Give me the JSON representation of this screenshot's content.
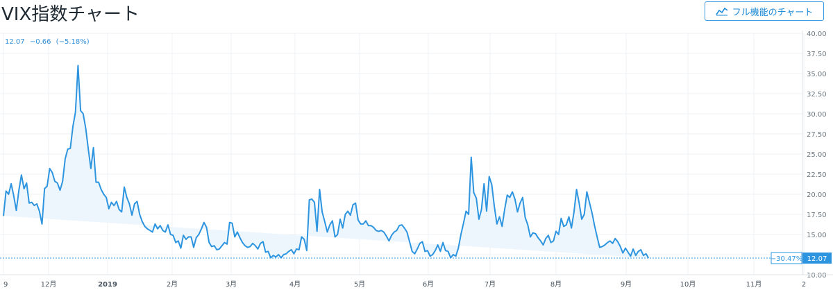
{
  "header": {
    "title": "VIX指数チャート",
    "full_chart_label": "フル機能のチャート",
    "full_chart_icon": "chart-line-icon"
  },
  "readout": {
    "last": "12.07",
    "change": "−0.66",
    "change_pct": "(−5.18%)"
  },
  "price_label": {
    "pct": "−30.47%",
    "value": "12.07"
  },
  "colors": {
    "line": "#2d95e0",
    "fill": "#eef6fd",
    "grid": "#eef1f4",
    "badge": "#2d95e0",
    "text": "#4a5560"
  },
  "chart_data": {
    "type": "area",
    "title": "VIX指数チャート",
    "ylim": [
      10,
      40
    ],
    "yticks": [
      "10.00",
      "12.50",
      "15.00",
      "17.50",
      "20.00",
      "22.50",
      "25.00",
      "27.50",
      "30.00",
      "32.50",
      "35.00",
      "37.50",
      "40.00"
    ],
    "xtick_labels": [
      "9",
      "12月",
      "2019",
      "2月",
      "3月",
      "4月",
      "5月",
      "6月",
      "7月",
      "8月",
      "9月",
      "10月",
      "11月",
      "2"
    ],
    "grid": true,
    "baseline": 12.07,
    "x": [
      1,
      2,
      3,
      4,
      5,
      6,
      7,
      8,
      9,
      10,
      11,
      12,
      13,
      14,
      15,
      16,
      17,
      18,
      19,
      20,
      21,
      22,
      23,
      24,
      25,
      26,
      27,
      28,
      29,
      30,
      31,
      32,
      33,
      34,
      35,
      36,
      37,
      38,
      39,
      40,
      41,
      42,
      43,
      44,
      45,
      46,
      47,
      48,
      49,
      50,
      51,
      52,
      53,
      54,
      55,
      56,
      57,
      58,
      59,
      60,
      61,
      62,
      63,
      64,
      65,
      66,
      67,
      68,
      69,
      70,
      71,
      72,
      73,
      74,
      75,
      76,
      77,
      78,
      79,
      80,
      81,
      82,
      83,
      84,
      85,
      86,
      87,
      88,
      89,
      90,
      91,
      92,
      93,
      94,
      95,
      96,
      97,
      98,
      99,
      100,
      101,
      102,
      103,
      104,
      105,
      106,
      107,
      108,
      109,
      110,
      111,
      112,
      113,
      114,
      115,
      116,
      117,
      118,
      119,
      120,
      121,
      122,
      123,
      124,
      125,
      126,
      127,
      128,
      129,
      130,
      131,
      132,
      133,
      134,
      135,
      136,
      137,
      138,
      139,
      140,
      141,
      142,
      143,
      144,
      145,
      146,
      147,
      148,
      149,
      150,
      151,
      152,
      153,
      154,
      155,
      156,
      157,
      158,
      159,
      160,
      161,
      162,
      163,
      164,
      165,
      166,
      167,
      168,
      169,
      170,
      171,
      172,
      173,
      174,
      175,
      176,
      177,
      178,
      179,
      180,
      181,
      182,
      183,
      184,
      185,
      186,
      187,
      188,
      189,
      190,
      191,
      192,
      193,
      194,
      195,
      196,
      197,
      198,
      199,
      200,
      201,
      202,
      203,
      204,
      205,
      206,
      207,
      208,
      209,
      210,
      211,
      212,
      213,
      214,
      215,
      216,
      217,
      218,
      219,
      220,
      221,
      222,
      223,
      224,
      225,
      226,
      227,
      228,
      229,
      230,
      231,
      232,
      233,
      234,
      235,
      236,
      237,
      238,
      239,
      240,
      241,
      242,
      243,
      244,
      245,
      246,
      247,
      248,
      249,
      250,
      251,
      252,
      253,
      254,
      255,
      256,
      257,
      258,
      259,
      260,
      261,
      262,
      263,
      264,
      265,
      266,
      267,
      268,
      269,
      270,
      271,
      272,
      273,
      274,
      275,
      276,
      277,
      278,
      279,
      280,
      281,
      282,
      283,
      284,
      285,
      286,
      287,
      288,
      289,
      290,
      291,
      292,
      293,
      294,
      295,
      296,
      297,
      298,
      299,
      300
    ],
    "series": [
      {
        "values": [
          17.3,
          20.4,
          20.0,
          21.3,
          19.8,
          18.0,
          20.5,
          22.4,
          20.7,
          21.4,
          18.9,
          19.0,
          18.6,
          18.8,
          17.9,
          16.3,
          20.7,
          21.0,
          23.2,
          22.7,
          21.6,
          21.4,
          20.5,
          21.6,
          24.4,
          25.6,
          25.7,
          28.4,
          30.2,
          36.0,
          30.4,
          30.0,
          28.2,
          25.6,
          23.2,
          25.8,
          21.5,
          21.5,
          20.6,
          20.0,
          19.6,
          18.2,
          19.0,
          18.6,
          19.1,
          18.1,
          17.8,
          20.9,
          19.6,
          18.8,
          17.4,
          18.8,
          19.1,
          17.5,
          16.6,
          16.0,
          15.7,
          15.5,
          15.3,
          16.3,
          15.7,
          16.1,
          15.5,
          15.3,
          16.2,
          15.0,
          14.9,
          14.0,
          14.2,
          13.3,
          14.9,
          14.4,
          14.7,
          14.7,
          13.4,
          14.6,
          15.0,
          15.7,
          16.5,
          15.9,
          14.0,
          13.5,
          13.6,
          13.1,
          13.2,
          13.6,
          14.0,
          13.8,
          16.5,
          16.4,
          14.7,
          15.3,
          14.6,
          14.0,
          13.6,
          13.4,
          13.5,
          13.9,
          13.6,
          13.2,
          13.9,
          14.1,
          12.8,
          12.9,
          12.1,
          12.4,
          12.2,
          12.5,
          12.1,
          12.5,
          12.6,
          12.9,
          13.1,
          12.6,
          13.2,
          13.1,
          14.7,
          14.4,
          13.0,
          19.3,
          19.4,
          19.0,
          15.4,
          20.6,
          17.8,
          16.6,
          15.3,
          16.2,
          16.7,
          14.7,
          15.0,
          16.9,
          15.8,
          17.5,
          17.9,
          17.4,
          18.7,
          18.9,
          16.8,
          16.3,
          16.3,
          16.7,
          16.1,
          16.1,
          15.9,
          15.5,
          15.4,
          15.5,
          15.3,
          14.8,
          14.2,
          14.9,
          15.3,
          15.5,
          16.1,
          16.2,
          15.8,
          15.3,
          14.1,
          12.9,
          12.6,
          13.2,
          13.9,
          14.1,
          12.9,
          13.0,
          12.3,
          12.5,
          13.0,
          13.7,
          12.9,
          14.0,
          13.0,
          12.9,
          12.1,
          12.5,
          12.3,
          13.3,
          15.0,
          16.4,
          17.9,
          17.5,
          24.6,
          20.2,
          19.5,
          16.9,
          18.1,
          21.3,
          17.9,
          22.2,
          21.2,
          18.5,
          16.3,
          17.2,
          16.0,
          18.1,
          19.9,
          19.6,
          20.3,
          19.4,
          17.8,
          18.9,
          19.6,
          17.1,
          16.2,
          14.7,
          15.2,
          15.1,
          14.6,
          14.2,
          13.7,
          14.5,
          14.9,
          14.0,
          14.2,
          15.4,
          15.0,
          17.0,
          16.0,
          16.2,
          17.2,
          15.8,
          17.8,
          20.6,
          18.9,
          16.9,
          17.5,
          20.3,
          19.0,
          17.7,
          16.1,
          14.7,
          13.4,
          13.5,
          13.7,
          14.0,
          14.2,
          13.9,
          14.5,
          14.1,
          13.5,
          12.7,
          13.3,
          12.8,
          12.3,
          13.2,
          12.4,
          12.9,
          13.1,
          12.4,
          12.6,
          12.07
        ]
      }
    ]
  }
}
